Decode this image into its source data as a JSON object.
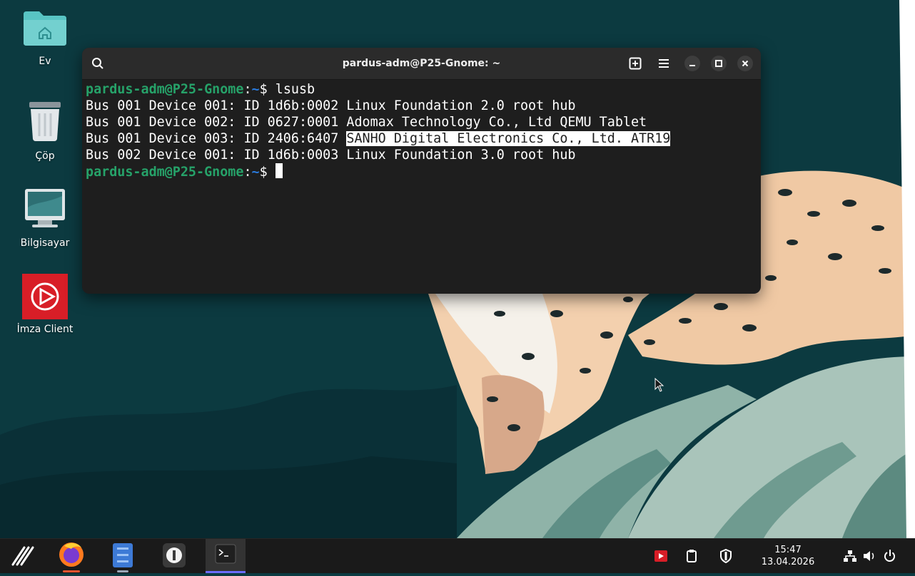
{
  "desktop": {
    "icons": [
      {
        "label": "Ev",
        "icon": "home-folder-icon"
      },
      {
        "label": "Çöp",
        "icon": "trash-icon"
      },
      {
        "label": "Bilgisayar",
        "icon": "computer-icon"
      },
      {
        "label": "İmza Client",
        "icon": "imza-client-icon"
      }
    ]
  },
  "terminal": {
    "title": "pardus-adm@P25-Gnome: ~",
    "lines": [
      {
        "user": "pardus-adm@P25-Gnome",
        "sep": ":",
        "path": "~",
        "sigil": "$ ",
        "cmd": "lsusb"
      },
      {
        "text": "Bus 001 Device 001: ID 1d6b:0002 Linux Foundation 2.0 root hub"
      },
      {
        "text": "Bus 001 Device 002: ID 0627:0001 Adomax Technology Co., Ltd QEMU Tablet"
      },
      {
        "prefix": "Bus 001 Device 003: ID 2406:6407 ",
        "highlight": "SANHO Digital Electronics Co., Ltd. ATR19"
      },
      {
        "text": "Bus 002 Device 001: ID 1d6b:0003 Linux Foundation 3.0 root hub"
      },
      {
        "user": "pardus-adm@P25-Gnome",
        "sep": ":",
        "path": "~",
        "sigil": "$ ",
        "cmd": ""
      }
    ]
  },
  "taskbar": {
    "apps": [
      "menu-icon",
      "firefox-icon",
      "file-manager-icon",
      "app-icon",
      "terminal-icon"
    ],
    "active_app": "terminal-icon",
    "clock": {
      "time": "15:47",
      "date": "13.04.2026"
    },
    "tray": [
      "imza-tray-icon",
      "clipboard-icon",
      "shield-icon",
      "network-icon",
      "volume-icon",
      "power-icon"
    ]
  },
  "colors": {
    "prompt_user": "#26a269",
    "prompt_path": "#2a7bde",
    "active_indicator": "#6c6cff",
    "firefox_indicator": "#e6542f"
  }
}
